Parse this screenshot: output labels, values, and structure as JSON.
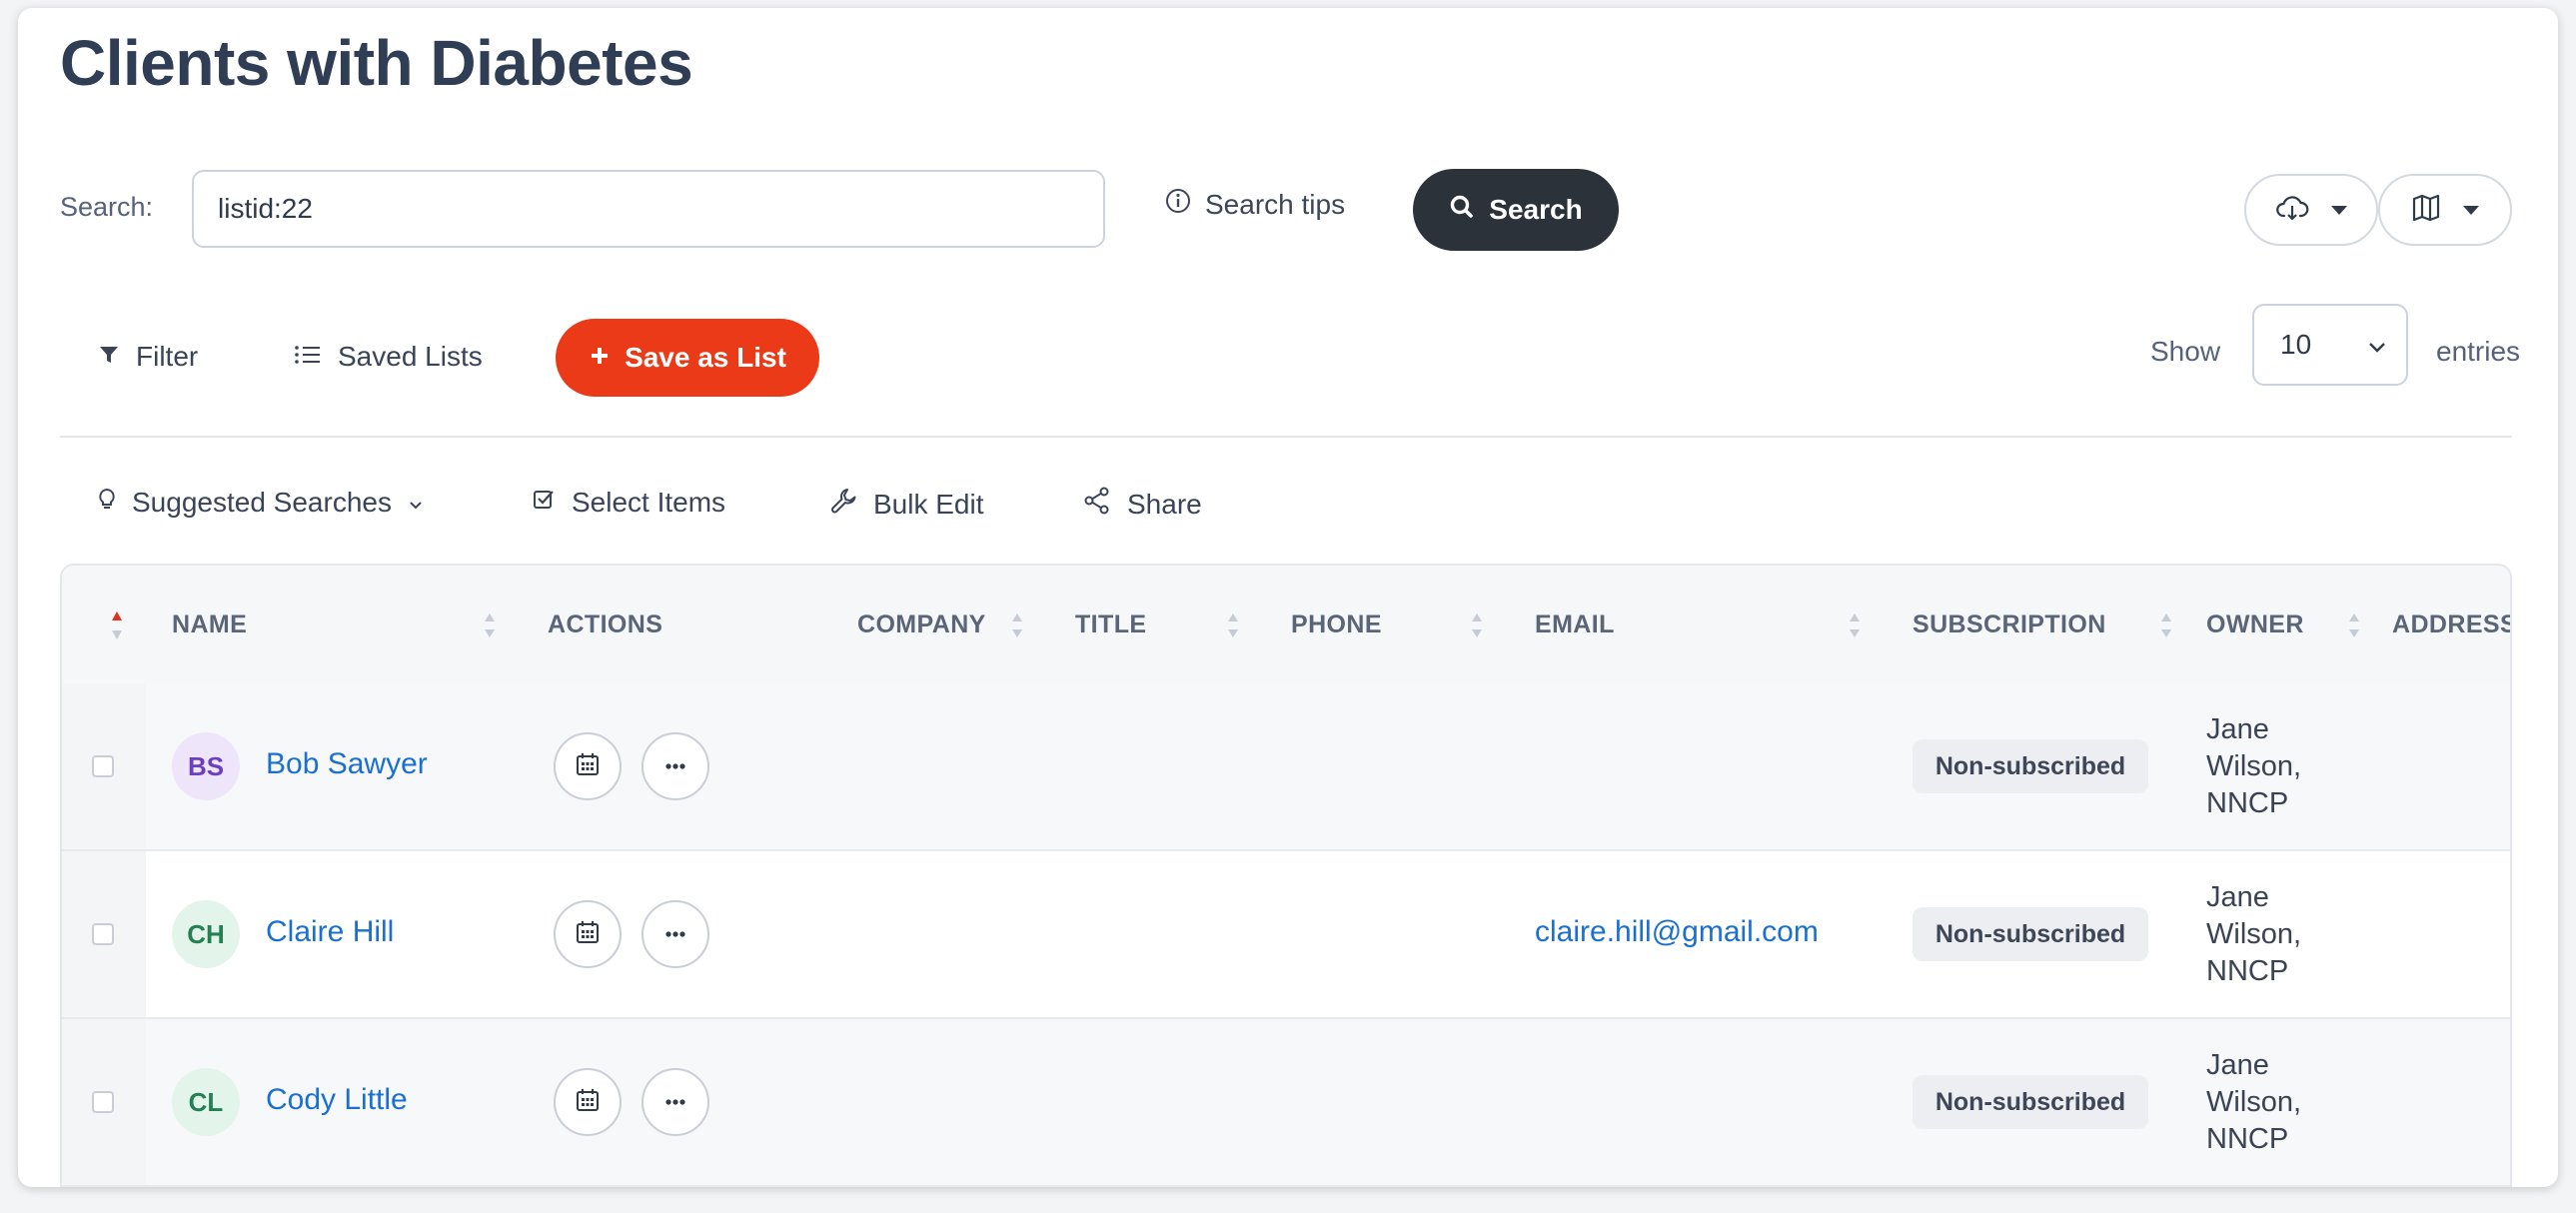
{
  "page": {
    "title": "Clients with Diabetes"
  },
  "search": {
    "label": "Search:",
    "value": "listid:22",
    "tips_label": "Search tips",
    "button_label": "Search"
  },
  "toolbar": {
    "filter_label": "Filter",
    "saved_lists_label": "Saved Lists",
    "save_as_list_label": "Save as List",
    "show_label": "Show",
    "entries_value": "10",
    "entries_label": "entries",
    "suggested_label": "Suggested Searches",
    "select_items_label": "Select Items",
    "bulk_edit_label": "Bulk Edit",
    "share_label": "Share"
  },
  "icons": {
    "cloud_download": "cloud-download-icon",
    "map": "map-icon"
  },
  "table": {
    "columns": [
      "NAME",
      "ACTIONS",
      "COMPANY",
      "TITLE",
      "PHONE",
      "EMAIL",
      "SUBSCRIPTION",
      "OWNER",
      "ADDRESS"
    ],
    "rows": [
      {
        "initials": "BS",
        "name": "Bob Sawyer",
        "email": "",
        "subscription": "Non-subscribed",
        "owner": "Jane Wilson, NNCP"
      },
      {
        "initials": "CH",
        "name": "Claire Hill",
        "email": "claire.hill@gmail.com",
        "subscription": "Non-subscribed",
        "owner": "Jane Wilson, NNCP"
      },
      {
        "initials": "CL",
        "name": "Cody Little",
        "email": "",
        "subscription": "Non-subscribed",
        "owner": "Jane Wilson, NNCP"
      }
    ]
  },
  "colors": {
    "primary_dark": "#2c323a",
    "accent_red": "#ea3a17",
    "link_blue": "#1a6fd1",
    "avatar_purple_bg": "#efe5fb",
    "avatar_purple_fg": "#6a3fc0",
    "avatar_green_bg": "#e3f4ea",
    "avatar_green_fg": "#238052"
  }
}
